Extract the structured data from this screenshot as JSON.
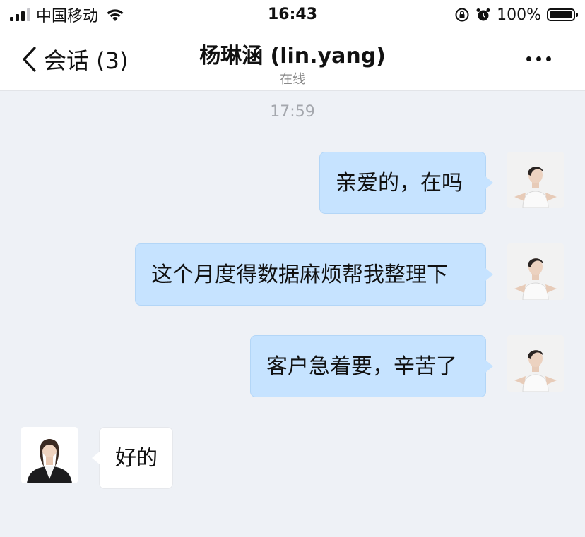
{
  "status_bar": {
    "carrier": "中国移动",
    "time": "16:43",
    "battery_percent": "100%",
    "icons": [
      "signal-icon",
      "wifi-icon",
      "orientation-lock-icon",
      "alarm-icon",
      "battery-icon"
    ]
  },
  "nav": {
    "back_label": "会话 (3)",
    "title": "杨琳涵 (lin.yang)",
    "subtitle": "在线",
    "icons": [
      "chevron-left-icon",
      "more-icon"
    ]
  },
  "chat": {
    "timestamp": "17:59",
    "messages": [
      {
        "direction": "out",
        "text": "亲爱的，在吗"
      },
      {
        "direction": "out",
        "text": "这个月度得数据麻烦帮我整理下"
      },
      {
        "direction": "out",
        "text": "客户急着要，辛苦了"
      },
      {
        "direction": "in",
        "text": "好的"
      }
    ]
  },
  "colors": {
    "outgoing_bubble": "#c6e3ff",
    "incoming_bubble": "#ffffff",
    "chat_background": "#eef1f6"
  }
}
